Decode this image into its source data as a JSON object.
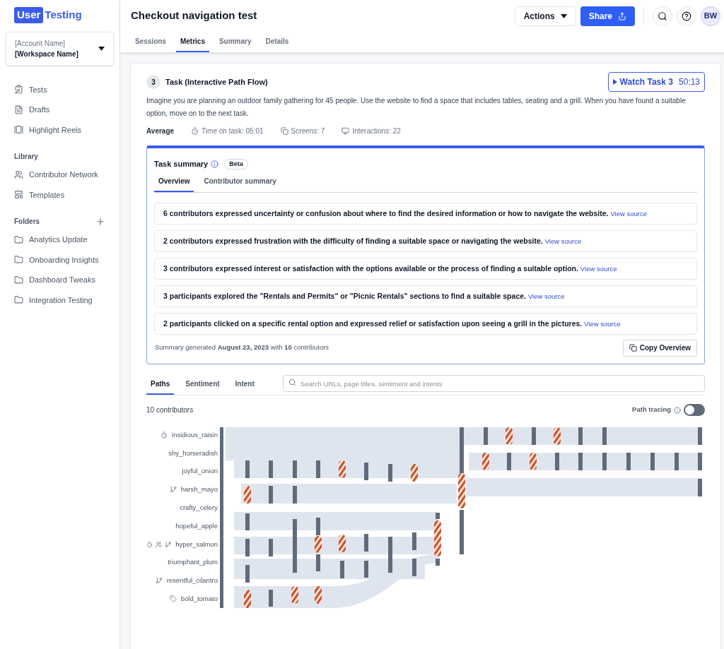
{
  "brand": {
    "part1": "User",
    "part2": "Testing"
  },
  "workspace": {
    "account": "[Account Name]",
    "workspace": "[Workspace Name]"
  },
  "sidebar": {
    "items": [
      {
        "kind": "tests",
        "label": "Tests"
      },
      {
        "kind": "drafts",
        "label": "Drafts"
      },
      {
        "kind": "reels",
        "label": "Highlight Reels"
      }
    ],
    "library_title": "Library",
    "library": [
      {
        "kind": "network",
        "label": "Contributor Network"
      },
      {
        "kind": "templates",
        "label": "Templates"
      }
    ],
    "folders_title": "Folders",
    "folders": [
      {
        "label": "Analytics Update"
      },
      {
        "label": "Onboarding Insights"
      },
      {
        "label": "Dashboard Tweaks"
      },
      {
        "label": "Integration Testing"
      }
    ]
  },
  "header": {
    "title": "Checkout navigation test",
    "actions": "Actions",
    "share": "Share",
    "avatar": "BW"
  },
  "tabs": [
    {
      "label": "Sessions",
      "selected": false
    },
    {
      "label": "Metrics",
      "selected": true
    },
    {
      "label": "Summary",
      "selected": false
    },
    {
      "label": "Details",
      "selected": false
    }
  ],
  "task": {
    "number": "3",
    "title": "Task (Interactive Path Flow)",
    "watch": "Watch Task 3",
    "duration": "50:13",
    "description": "Imagine you are planning an outdoor family gathering for 45 people. Use the website to find a space that includes tables, seating and a grill. When you have found a suitable option, move on to the next task.",
    "average": "Average",
    "time": "Time on task: 05:01",
    "screens": "Screens: 7",
    "interactions": "Interactions: 22"
  },
  "summary": {
    "title": "Task summary",
    "badge": "Beta",
    "tabs": [
      {
        "label": "Overview",
        "selected": true
      },
      {
        "label": "Contributor summary",
        "selected": false
      }
    ],
    "items": [
      {
        "text": "6 contributors expressed uncertainty or confusion about where to find the desired information or how to navigate the website.",
        "link": "View source"
      },
      {
        "text": "2 contributors expressed frustration with the difficulty of finding a suitable space or navigating the website.",
        "link": "View source"
      },
      {
        "text": "3 contributors expressed interest or satisfaction with the options available or the process of finding a suitable option.",
        "link": "View source"
      },
      {
        "text": "3 participants explored the \"Rentals and Permits\" or \"Picnic Rentals\" sections to find a suitable space.",
        "link": "View source"
      },
      {
        "text": "2 participants clicked on a specific rental option and expressed relief or satisfaction upon seeing a grill in the pictures.",
        "link": "View source"
      }
    ],
    "footer": "Summary generated **August 23, 2023** with **10** contributors",
    "copy": "Copy Overview"
  },
  "path_tabs": [
    {
      "label": "Paths",
      "selected": true
    },
    {
      "label": "Sentiment",
      "selected": false
    },
    {
      "label": "Intent",
      "selected": false
    }
  ],
  "search": {
    "placeholder": "Search URLs, page titles, sentiment and intents"
  },
  "count": "10 contributors",
  "path_tracing": {
    "label": "Path tracing",
    "on": false
  },
  "contributors": [
    {
      "name": "insidious_raisin",
      "badges": [
        {
          "kind": "timer"
        }
      ]
    },
    {
      "name": "shy_horseradish"
    },
    {
      "name": "joyful_onion"
    },
    {
      "name": "harsh_mayo",
      "badges": [
        {
          "kind": "branch"
        }
      ]
    },
    {
      "name": "crafty_celery"
    },
    {
      "name": "hopeful_apple"
    },
    {
      "name": "hyper_salmon",
      "badges": [
        {
          "kind": "timer"
        },
        {
          "kind": "network"
        },
        {
          "kind": "branch"
        }
      ]
    },
    {
      "name": "triumphant_plum"
    },
    {
      "name": "resentful_cilantro",
      "badges": [
        {
          "kind": "branch"
        }
      ]
    },
    {
      "name": "bold_tomato",
      "badges": [
        {
          "kind": "tag"
        }
      ]
    }
  ]
}
